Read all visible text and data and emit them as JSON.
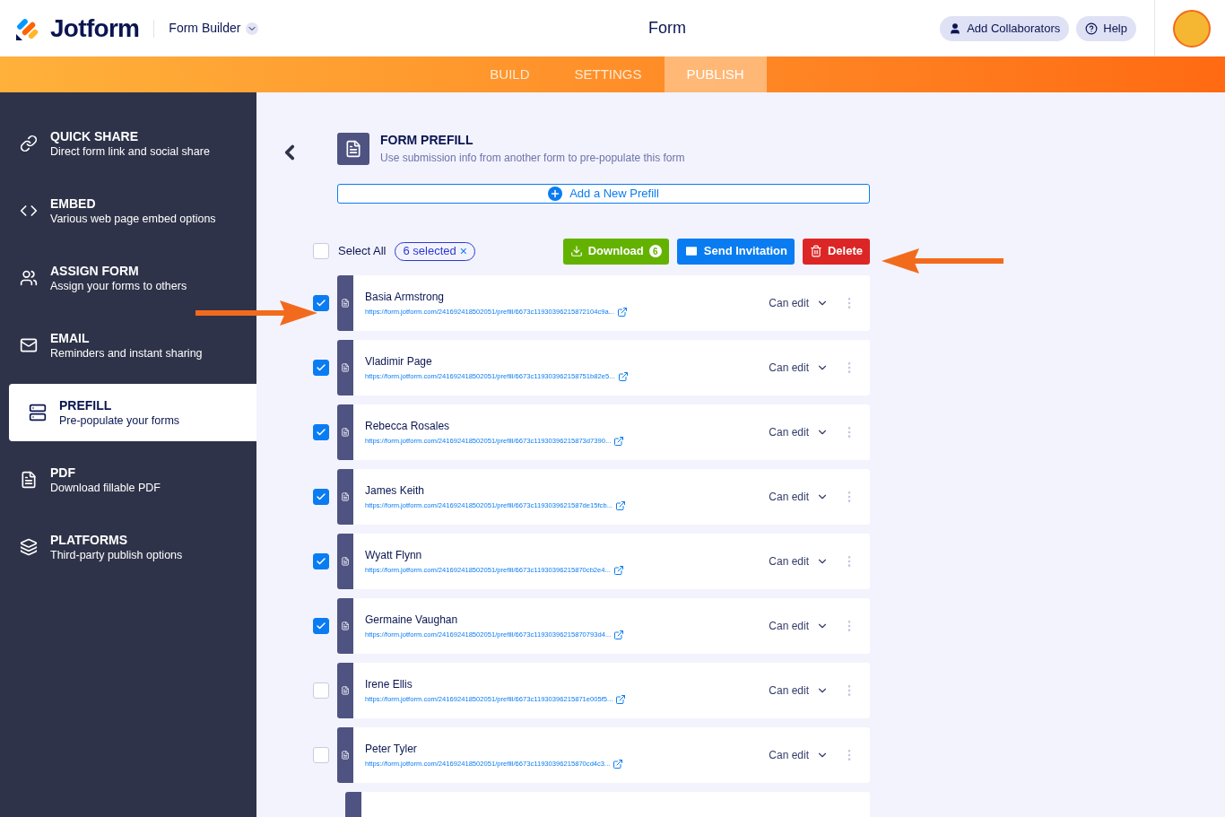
{
  "header": {
    "brand": "Jotform",
    "builder_menu": "Form Builder",
    "title": "Form",
    "collaborators_button": "Add Collaborators",
    "help_button": "Help"
  },
  "tabs": [
    {
      "label": "BUILD",
      "selected": false
    },
    {
      "label": "SETTINGS",
      "selected": false
    },
    {
      "label": "PUBLISH",
      "selected": true
    }
  ],
  "sidebar": {
    "items": [
      {
        "kind": "link",
        "title": "QUICK SHARE",
        "subtitle": "Direct form link and social share",
        "selected": false
      },
      {
        "kind": "code",
        "title": "EMBED",
        "subtitle": "Various web page embed options",
        "selected": false
      },
      {
        "kind": "users",
        "title": "ASSIGN FORM",
        "subtitle": "Assign your forms to others",
        "selected": false
      },
      {
        "kind": "mail",
        "title": "EMAIL",
        "subtitle": "Reminders and instant sharing",
        "selected": false
      },
      {
        "kind": "prefill",
        "title": "PREFILL",
        "subtitle": "Pre-populate your forms",
        "selected": true
      },
      {
        "kind": "pdf",
        "title": "PDF",
        "subtitle": "Download fillable PDF",
        "selected": false
      },
      {
        "kind": "layers",
        "title": "PLATFORMS",
        "subtitle": "Third-party publish options",
        "selected": false
      }
    ]
  },
  "prefill": {
    "title": "FORM PREFILL",
    "description": "Use submission info from another form to pre-populate this form",
    "add_button": "Add a New Prefill",
    "toolbar": {
      "select_all": "Select All",
      "select_all_checked": false,
      "selected_chip": "6 selected",
      "chip_close": "×",
      "download": "Download",
      "download_count": "6",
      "send": "Send Invitation",
      "delete": "Delete"
    },
    "rows": [
      {
        "name": "Basia Armstrong",
        "url": "https://form.jotform.com/241692418502051/prefill/6673c11930396215872104c9a...",
        "permission": "Can edit",
        "checked": true
      },
      {
        "name": "Vladimir Page",
        "url": "https://form.jotform.com/241692418502051/prefill/6673c119303962158751b82e5...",
        "permission": "Can edit",
        "checked": true
      },
      {
        "name": "Rebecca Rosales",
        "url": "https://form.jotform.com/241692418502051/prefill/6673c11930396215873d7390...",
        "permission": "Can edit",
        "checked": true
      },
      {
        "name": "James Keith",
        "url": "https://form.jotform.com/241692418502051/prefill/6673c1193039621587de15fcb...",
        "permission": "Can edit",
        "checked": true
      },
      {
        "name": "Wyatt Flynn",
        "url": "https://form.jotform.com/241692418502051/prefill/6673c11930396215870cb2e4...",
        "permission": "Can edit",
        "checked": true
      },
      {
        "name": "Germaine Vaughan",
        "url": "https://form.jotform.com/241692418502051/prefill/6673c11930396215870793d4...",
        "permission": "Can edit",
        "checked": true
      },
      {
        "name": "Irene Ellis",
        "url": "https://form.jotform.com/241692418502051/prefill/6673c11930396215871e005f5...",
        "permission": "Can edit",
        "checked": false
      },
      {
        "name": "Peter Tyler",
        "url": "https://form.jotform.com/241692418502051/prefill/6673c11930396215870cd4c3...",
        "permission": "Can edit",
        "checked": false
      }
    ]
  }
}
